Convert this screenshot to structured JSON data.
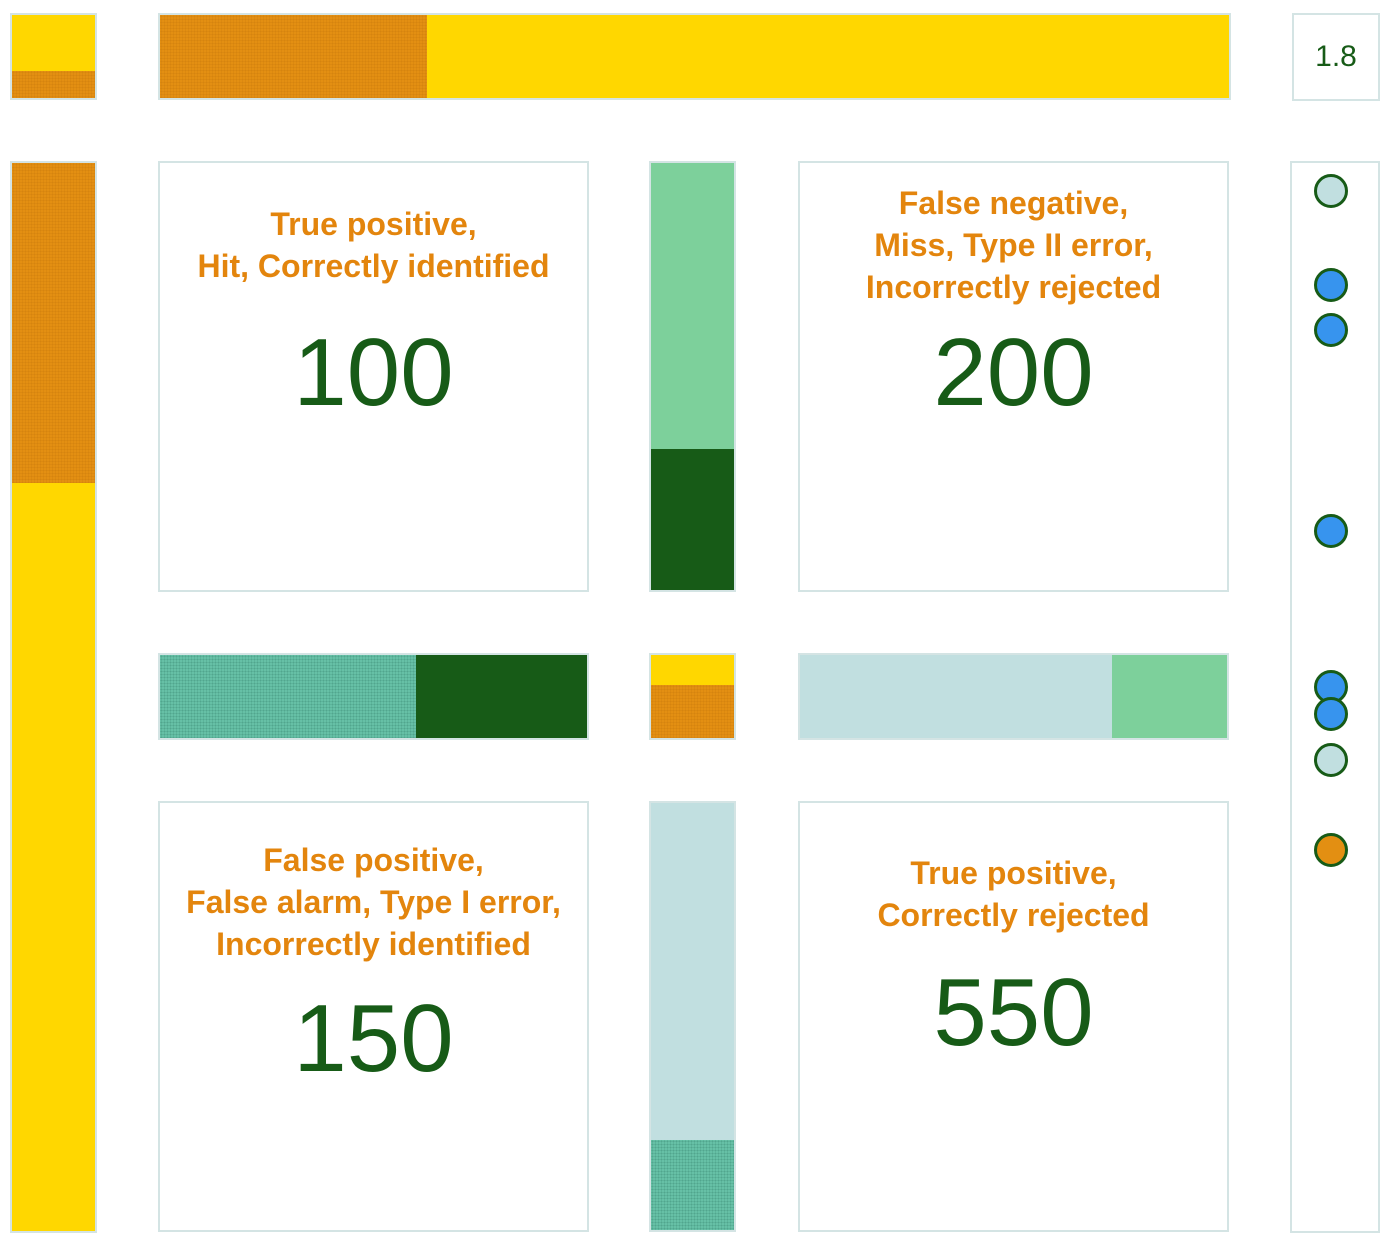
{
  "score": {
    "value": "1.8"
  },
  "quadrants": {
    "top_left": {
      "label_lines": [
        "True positive,",
        "Hit, Correctly identified"
      ],
      "value": "100"
    },
    "top_right": {
      "label_lines": [
        "False negative,",
        "Miss, Type II error,",
        "Incorrectly rejected"
      ],
      "value": "200"
    },
    "bottom_left": {
      "label_lines": [
        "False positive,",
        "False alarm, Type I error,",
        "Incorrectly identified"
      ],
      "value": "150"
    },
    "bottom_right": {
      "label_lines": [
        "True positive,",
        "Correctly rejected"
      ],
      "value": "550"
    }
  },
  "proportion_bars": {
    "top_corner": {
      "orange_fraction": 0.33
    },
    "top_horizontal": {
      "orange_fraction": 0.25
    },
    "left_vertical": {
      "orange_fraction": 0.3
    },
    "center_corner": {
      "orange_fraction": 0.64
    },
    "upper_vertical": {
      "dark_green_fraction": 0.33
    },
    "left_horizontal": {
      "dark_green_fraction": 0.4
    },
    "right_horizontal": {
      "mint_fraction": 0.27
    },
    "lower_vertical": {
      "teal_fraction": 0.21
    }
  },
  "colors": {
    "yellow": "#ffd700",
    "orange": "#e38f12",
    "mint": "#7dd09b",
    "dark_green": "#175b17",
    "teal": "#66c0a6",
    "light_blue": "#c1dfe0",
    "blue": "#3794ee",
    "label_orange": "#e3850d"
  },
  "markers": [
    {
      "kind": "light",
      "icon": "circle-marker-icon"
    },
    {
      "kind": "blue",
      "icon": "circle-marker-icon"
    },
    {
      "kind": "blue",
      "icon": "circle-marker-icon"
    },
    {
      "kind": "blue",
      "icon": "circle-marker-icon"
    },
    {
      "kind": "blue",
      "icon": "circle-marker-icon"
    },
    {
      "kind": "blue",
      "icon": "circle-marker-icon"
    },
    {
      "kind": "light",
      "icon": "circle-marker-icon"
    },
    {
      "kind": "orange",
      "icon": "circle-marker-icon"
    }
  ]
}
